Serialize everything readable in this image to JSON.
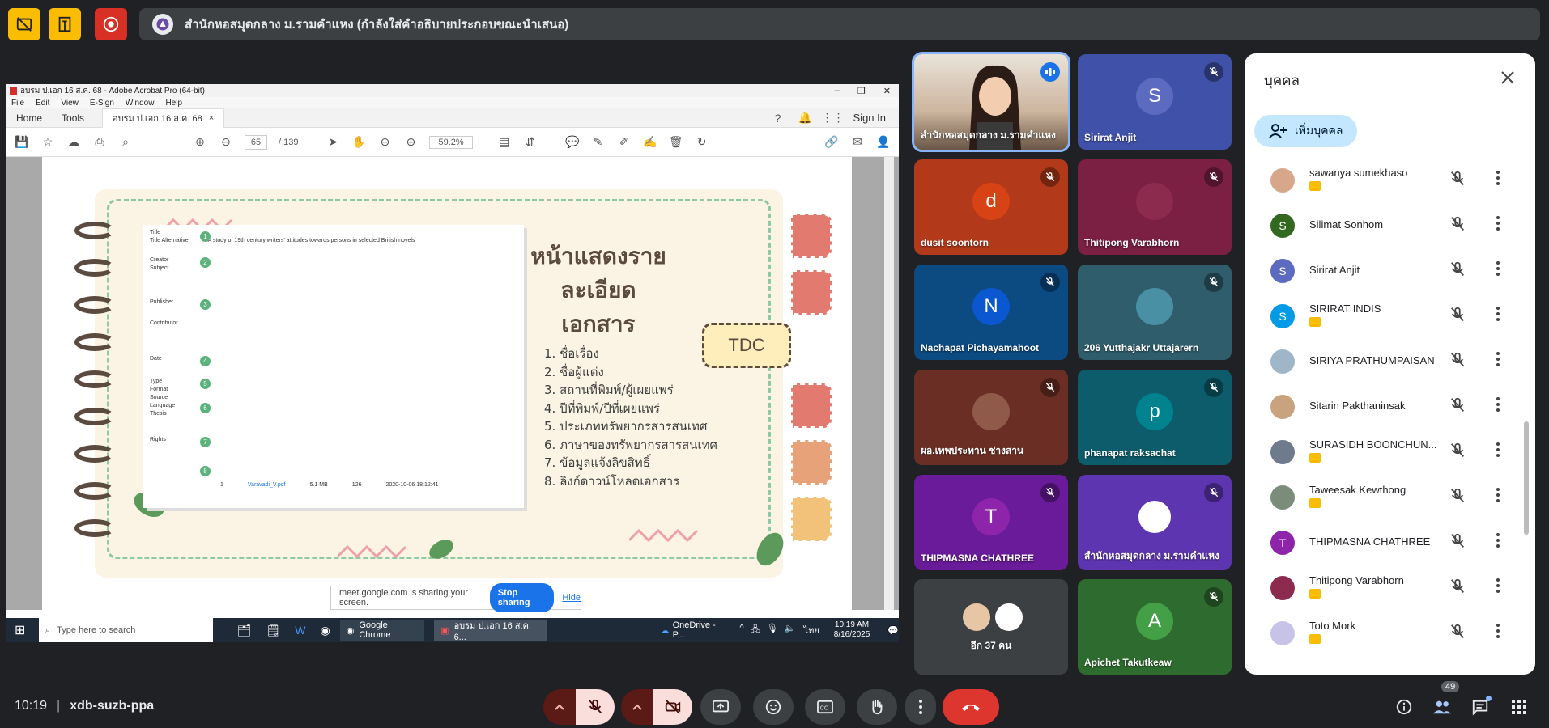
{
  "topbar": {
    "presenting_title": "สำนักหอสมุดกลาง ม.รามคำแหง (กำลังใส่คำอธิบายประกอบขณะนำเสนอ)"
  },
  "acrobat": {
    "window_title": "อบรม ป.เอก 16 ส.ค. 68 - Adobe Acrobat Pro (64-bit)",
    "menu": [
      "File",
      "Edit",
      "View",
      "E-Sign",
      "Window",
      "Help"
    ],
    "tabs": [
      "Home",
      "Tools",
      "อบรม ป.เอก 16 ส.ค. 68"
    ],
    "sign_in": "Sign In",
    "page_current": "65",
    "page_total": "/ 139",
    "zoom": "59.2%"
  },
  "slide": {
    "heading_line1": "หน้าแสดงรายละเอียด",
    "heading_line2": "เอกสาร",
    "items": [
      "1. ชื่อเรื่อง",
      "2. ชื่อผู้แต่ง",
      "3. สถานที่พิมพ์/ผู้เผยแพร่",
      "4. ปีที่พิมพ์/ปีที่เผยแพร่",
      "5. ประเภททรัพยากรสารสนเทศ",
      "6. ภาษาของทรัพยากรสารสนเทศ",
      "7. ข้อมูลแจ้งลิขสิทธิ์",
      "8. ลิงก์ดาวน์โหลดเอกสาร"
    ],
    "tdc": "TDC",
    "meta_labels": [
      "Title",
      "Title Alternative",
      "Creator",
      "Subject",
      "Publisher",
      "Contributor",
      "Date",
      "Type",
      "Format",
      "Source",
      "Language",
      "Thesis",
      "Rights"
    ],
    "meta_title_alt": "A study of 19th century writers' attitudes towards persons in selected British novels",
    "file_name": "Varavadi_V.pdf",
    "file_size": "5.1 MB",
    "file_count": "126",
    "file_date": "2020-10-06 18:12:41"
  },
  "share_notice": {
    "text": "meet.google.com is sharing your screen.",
    "stop": "Stop sharing",
    "hide": "Hide"
  },
  "taskbar": {
    "search_placeholder": "Type here to search",
    "app1": "Google Chrome",
    "app2": "อบรม ป.เอก 16 ส.ค. 6...",
    "onedrive": "OneDrive - P...",
    "lang": "ไทย",
    "time": "10:19 AM",
    "date": "8/16/2025"
  },
  "tiles": [
    {
      "name": "สำนักหอสมุดกลาง ม.รามคำแหง",
      "initial": "",
      "bg": "#c9a07a",
      "avatar_bg": "",
      "speaking": true
    },
    {
      "name": "Sirirat Anjit",
      "initial": "S",
      "bg": "#3f51a8",
      "avatar_bg": "#5c6bc0"
    },
    {
      "name": "dusit soontorn",
      "initial": "d",
      "bg": "#b23a1a",
      "avatar_bg": "#d84315"
    },
    {
      "name": "Thitipong Varabhorn",
      "initial": "",
      "bg": "#7b1f43",
      "avatar_bg": "#8d2b4f"
    },
    {
      "name": "Nachapat Pichayamahoot",
      "initial": "N",
      "bg": "#0c4a82",
      "avatar_bg": "#0b57d0"
    },
    {
      "name": "206 Yutthajakr Uttajarern",
      "initial": "",
      "bg": "#2f5d6b",
      "avatar_bg": "#4a90a4"
    },
    {
      "name": "ผอ.เทพประทาน ช่างสาน",
      "initial": "",
      "bg": "#6b2e24",
      "avatar_bg": "#8f5a4a"
    },
    {
      "name": "phanapat raksachat",
      "initial": "p",
      "bg": "#0d5c6b",
      "avatar_bg": "#00838f"
    },
    {
      "name": "THIPMASNA CHATHREE",
      "initial": "T",
      "bg": "#6a1b9a",
      "avatar_bg": "#8e24aa"
    },
    {
      "name": "สำนักหอสมุดกลาง ม.รามคำแหง",
      "initial": "",
      "bg": "#5e35b1",
      "avatar_bg": "#ffffff"
    },
    {
      "name": "อีก 37 คน",
      "initial": "",
      "bg": "#3c4043",
      "avatar_bg": ""
    },
    {
      "name": "Apichet Takutkeaw",
      "initial": "A",
      "bg": "#2e6b2e",
      "avatar_bg": "#43a047"
    }
  ],
  "people_panel": {
    "title": "บุคคล",
    "add_label": "เพิ่มบุคคล",
    "people": [
      {
        "name": "sawanya sumekhaso",
        "initial": "",
        "color": "#d7a78c",
        "badge": true
      },
      {
        "name": "Silimat Sonhom",
        "initial": "S",
        "color": "#33691e",
        "badge": false
      },
      {
        "name": "Sirirat Anjit",
        "initial": "S",
        "color": "#5c6bc0",
        "badge": false
      },
      {
        "name": "SIRIRAT INDIS",
        "initial": "S",
        "color": "#039be5",
        "badge": true
      },
      {
        "name": "SIRIYA PRATHUMPAISAN",
        "initial": "",
        "color": "#9fb6c8",
        "badge": false
      },
      {
        "name": "Sitarin Pakthaninsak",
        "initial": "",
        "color": "#c9a27e",
        "badge": false
      },
      {
        "name": "SURASIDH BOONCHUN...",
        "initial": "",
        "color": "#6d7b8c",
        "badge": true
      },
      {
        "name": "Taweesak Kewthong",
        "initial": "",
        "color": "#7c8c7a",
        "badge": true
      },
      {
        "name": "THIPMASNA CHATHREE",
        "initial": "T",
        "color": "#8e24aa",
        "badge": false
      },
      {
        "name": "Thitipong Varabhorn",
        "initial": "",
        "color": "#8d2b4f",
        "badge": true
      },
      {
        "name": "Toto Mork",
        "initial": "",
        "color": "#c7c3e8",
        "badge": true
      }
    ]
  },
  "bottom": {
    "time": "10:19",
    "meeting_code": "xdb-suzb-ppa",
    "participant_count": "49"
  }
}
